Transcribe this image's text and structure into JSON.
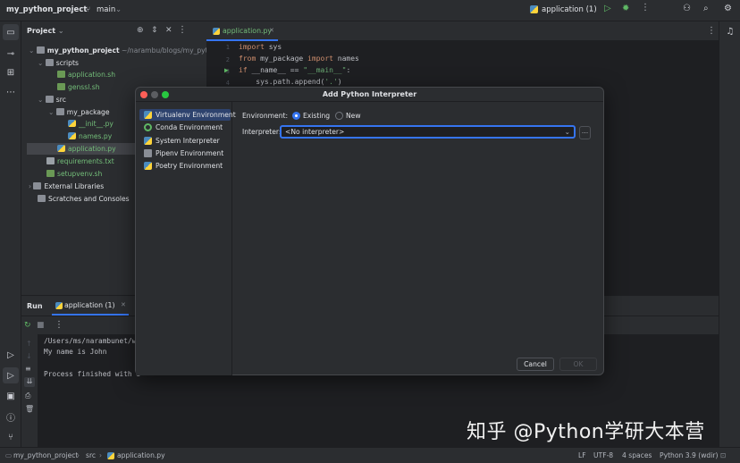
{
  "topbar": {
    "project_name": "my_python_project",
    "branch": "main",
    "run_config": "application (1)"
  },
  "project_panel": {
    "title": "Project",
    "root_name": "my_python_project",
    "root_path": "~/narambu/blogs/my_python_",
    "items": [
      {
        "label": "scripts"
      },
      {
        "label": "application.sh"
      },
      {
        "label": "genssl.sh"
      },
      {
        "label": "src"
      },
      {
        "label": "my_package"
      },
      {
        "label": "__init__.py"
      },
      {
        "label": "names.py"
      },
      {
        "label": "application.py"
      },
      {
        "label": "requirements.txt"
      },
      {
        "label": "setupvenv.sh"
      },
      {
        "label": "External Libraries"
      },
      {
        "label": "Scratches and Consoles"
      }
    ]
  },
  "editor": {
    "tab": "application.py",
    "line_numbers": [
      "1",
      "2",
      "3",
      "4"
    ],
    "lines": [
      {
        "kw1": "import",
        "rest": " sys"
      },
      {
        "kw1": "from",
        "mid": " my_package ",
        "kw2": "import",
        "rest": " names"
      },
      {
        "kw1": "if",
        "mid": " __name__ == ",
        "str": "\"__main__\"",
        "rest": ":"
      },
      {
        "indent": "    sys.path.append(",
        "str": "'.'",
        "rest": ")"
      }
    ]
  },
  "run_panel": {
    "title": "Run",
    "tab": "application (1)",
    "output": [
      "/Users/ms/narambunet/w",
      "My name is John",
      "",
      "Process finished with e"
    ]
  },
  "dialog": {
    "title": "Add Python Interpreter",
    "environments": [
      {
        "label": "Virtualenv Environment",
        "selected": true
      },
      {
        "label": "Conda Environment"
      },
      {
        "label": "System Interpreter"
      },
      {
        "label": "Pipenv Environment"
      },
      {
        "label": "Poetry Environment"
      }
    ],
    "environment_label": "Environment:",
    "existing_label": "Existing",
    "new_label": "New",
    "interpreter_label": "Interpreter:",
    "interpreter_value": "<No interpreter>",
    "browse_label": "...",
    "cancel_label": "Cancel",
    "ok_label": "OK"
  },
  "status": {
    "breadcrumb": [
      "my_python_project",
      "src",
      "application.py"
    ],
    "line_ending": "LF",
    "encoding": "UTF-8",
    "indent": "4 spaces",
    "interpreter": "Python 3.9 (wdir)"
  },
  "watermark": "知乎 @Python学研大本营",
  "colors": {
    "accent": "#3574f0",
    "selection": "#2e436e",
    "run_green": "#5fb865"
  }
}
